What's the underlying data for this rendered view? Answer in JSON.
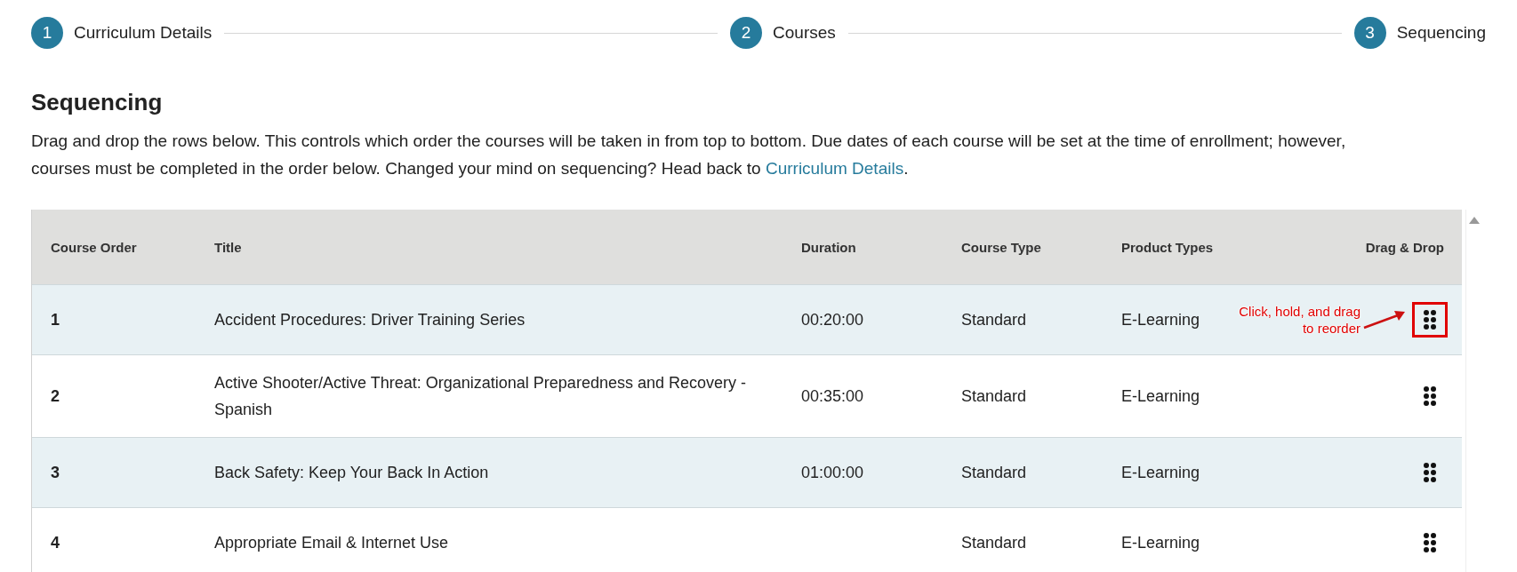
{
  "stepper": {
    "steps": [
      {
        "number": "1",
        "label": "Curriculum Details"
      },
      {
        "number": "2",
        "label": "Courses"
      },
      {
        "number": "3",
        "label": "Sequencing"
      }
    ]
  },
  "heading": "Sequencing",
  "description": {
    "text": "Drag and drop the rows below. This controls which order the courses will be taken in from top to bottom. Due dates of each course will be set at the time of enrollment; however, courses must be completed in the order below. Changed your mind on sequencing? Head back to ",
    "link": "Curriculum Details",
    "after": "."
  },
  "table": {
    "columns": [
      "Course Order",
      "Title",
      "Duration",
      "Course Type",
      "Product Types",
      "Drag & Drop"
    ],
    "rows": [
      {
        "order": "1",
        "title": "Accident Procedures: Driver Training Series",
        "duration": "00:20:00",
        "course_type": "Standard",
        "product_types": "E-Learning",
        "callout": "Click, hold, and drag to reorder"
      },
      {
        "order": "2",
        "title": "Active Shooter/Active Threat: Organizational Preparedness and Recovery - Spanish",
        "duration": "00:35:00",
        "course_type": "Standard",
        "product_types": "E-Learning"
      },
      {
        "order": "3",
        "title": "Back Safety: Keep Your Back In Action",
        "duration": "01:00:00",
        "course_type": "Standard",
        "product_types": "E-Learning"
      },
      {
        "order": "4",
        "title": "Appropriate Email & Internet Use",
        "course_type": "Standard",
        "product_types": "E-Learning"
      }
    ]
  }
}
